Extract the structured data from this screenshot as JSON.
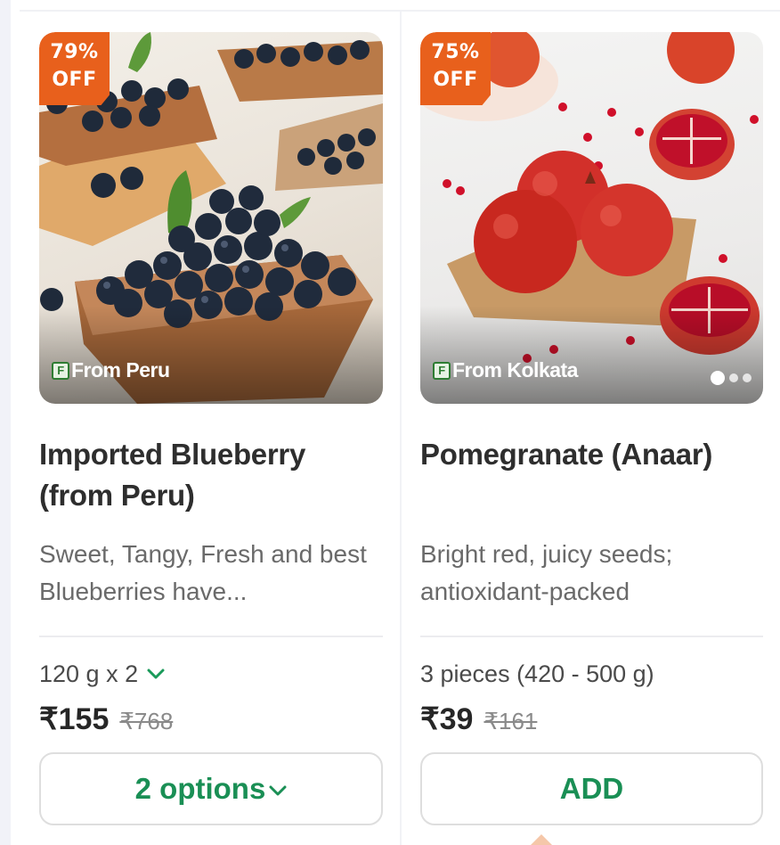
{
  "products": [
    {
      "discount_pct": "79%",
      "discount_off": "OFF",
      "origin": "From Peru",
      "name": "Imported Blueberry (from Peru)",
      "description": "Sweet, Tangy, Fresh and best Blueberries have...",
      "quantity": "120 g x 2",
      "price": "₹155",
      "mrp": "₹768",
      "button_label": "2 options",
      "button_icon": "chevron-down-icon"
    },
    {
      "discount_pct": "75%",
      "discount_off": "OFF",
      "origin": "From Kolkata",
      "name": "Pomegranate (Anaar)",
      "description": "Bright red, juicy seeds; antioxidant-packed",
      "quantity": "3 pieces (420 - 500 g)",
      "price": "₹39",
      "mrp": "₹161",
      "button_label": "ADD",
      "image_carousel": {
        "slides": 3,
        "active": 1
      }
    }
  ],
  "colors": {
    "discount_badge": "#e8601c",
    "accent_green": "#1a8f55",
    "text_primary": "#2e2e2e",
    "text_secondary": "#6a6a6a"
  }
}
